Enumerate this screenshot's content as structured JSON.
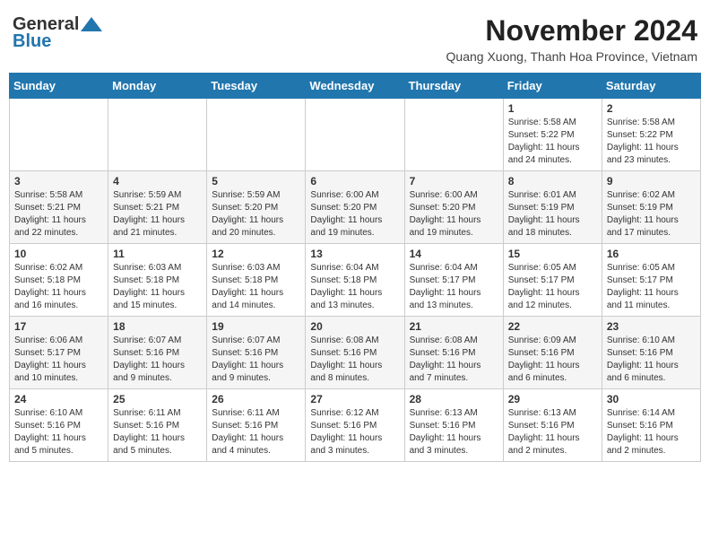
{
  "header": {
    "logo_line1": "General",
    "logo_line2": "Blue",
    "month_title": "November 2024",
    "location": "Quang Xuong, Thanh Hoa Province, Vietnam"
  },
  "weekdays": [
    "Sunday",
    "Monday",
    "Tuesday",
    "Wednesday",
    "Thursday",
    "Friday",
    "Saturday"
  ],
  "weeks": [
    [
      {
        "day": "",
        "info": ""
      },
      {
        "day": "",
        "info": ""
      },
      {
        "day": "",
        "info": ""
      },
      {
        "day": "",
        "info": ""
      },
      {
        "day": "",
        "info": ""
      },
      {
        "day": "1",
        "info": "Sunrise: 5:58 AM\nSunset: 5:22 PM\nDaylight: 11 hours\nand 24 minutes."
      },
      {
        "day": "2",
        "info": "Sunrise: 5:58 AM\nSunset: 5:22 PM\nDaylight: 11 hours\nand 23 minutes."
      }
    ],
    [
      {
        "day": "3",
        "info": "Sunrise: 5:58 AM\nSunset: 5:21 PM\nDaylight: 11 hours\nand 22 minutes."
      },
      {
        "day": "4",
        "info": "Sunrise: 5:59 AM\nSunset: 5:21 PM\nDaylight: 11 hours\nand 21 minutes."
      },
      {
        "day": "5",
        "info": "Sunrise: 5:59 AM\nSunset: 5:20 PM\nDaylight: 11 hours\nand 20 minutes."
      },
      {
        "day": "6",
        "info": "Sunrise: 6:00 AM\nSunset: 5:20 PM\nDaylight: 11 hours\nand 19 minutes."
      },
      {
        "day": "7",
        "info": "Sunrise: 6:00 AM\nSunset: 5:20 PM\nDaylight: 11 hours\nand 19 minutes."
      },
      {
        "day": "8",
        "info": "Sunrise: 6:01 AM\nSunset: 5:19 PM\nDaylight: 11 hours\nand 18 minutes."
      },
      {
        "day": "9",
        "info": "Sunrise: 6:02 AM\nSunset: 5:19 PM\nDaylight: 11 hours\nand 17 minutes."
      }
    ],
    [
      {
        "day": "10",
        "info": "Sunrise: 6:02 AM\nSunset: 5:18 PM\nDaylight: 11 hours\nand 16 minutes."
      },
      {
        "day": "11",
        "info": "Sunrise: 6:03 AM\nSunset: 5:18 PM\nDaylight: 11 hours\nand 15 minutes."
      },
      {
        "day": "12",
        "info": "Sunrise: 6:03 AM\nSunset: 5:18 PM\nDaylight: 11 hours\nand 14 minutes."
      },
      {
        "day": "13",
        "info": "Sunrise: 6:04 AM\nSunset: 5:18 PM\nDaylight: 11 hours\nand 13 minutes."
      },
      {
        "day": "14",
        "info": "Sunrise: 6:04 AM\nSunset: 5:17 PM\nDaylight: 11 hours\nand 13 minutes."
      },
      {
        "day": "15",
        "info": "Sunrise: 6:05 AM\nSunset: 5:17 PM\nDaylight: 11 hours\nand 12 minutes."
      },
      {
        "day": "16",
        "info": "Sunrise: 6:05 AM\nSunset: 5:17 PM\nDaylight: 11 hours\nand 11 minutes."
      }
    ],
    [
      {
        "day": "17",
        "info": "Sunrise: 6:06 AM\nSunset: 5:17 PM\nDaylight: 11 hours\nand 10 minutes."
      },
      {
        "day": "18",
        "info": "Sunrise: 6:07 AM\nSunset: 5:16 PM\nDaylight: 11 hours\nand 9 minutes."
      },
      {
        "day": "19",
        "info": "Sunrise: 6:07 AM\nSunset: 5:16 PM\nDaylight: 11 hours\nand 9 minutes."
      },
      {
        "day": "20",
        "info": "Sunrise: 6:08 AM\nSunset: 5:16 PM\nDaylight: 11 hours\nand 8 minutes."
      },
      {
        "day": "21",
        "info": "Sunrise: 6:08 AM\nSunset: 5:16 PM\nDaylight: 11 hours\nand 7 minutes."
      },
      {
        "day": "22",
        "info": "Sunrise: 6:09 AM\nSunset: 5:16 PM\nDaylight: 11 hours\nand 6 minutes."
      },
      {
        "day": "23",
        "info": "Sunrise: 6:10 AM\nSunset: 5:16 PM\nDaylight: 11 hours\nand 6 minutes."
      }
    ],
    [
      {
        "day": "24",
        "info": "Sunrise: 6:10 AM\nSunset: 5:16 PM\nDaylight: 11 hours\nand 5 minutes."
      },
      {
        "day": "25",
        "info": "Sunrise: 6:11 AM\nSunset: 5:16 PM\nDaylight: 11 hours\nand 5 minutes."
      },
      {
        "day": "26",
        "info": "Sunrise: 6:11 AM\nSunset: 5:16 PM\nDaylight: 11 hours\nand 4 minutes."
      },
      {
        "day": "27",
        "info": "Sunrise: 6:12 AM\nSunset: 5:16 PM\nDaylight: 11 hours\nand 3 minutes."
      },
      {
        "day": "28",
        "info": "Sunrise: 6:13 AM\nSunset: 5:16 PM\nDaylight: 11 hours\nand 3 minutes."
      },
      {
        "day": "29",
        "info": "Sunrise: 6:13 AM\nSunset: 5:16 PM\nDaylight: 11 hours\nand 2 minutes."
      },
      {
        "day": "30",
        "info": "Sunrise: 6:14 AM\nSunset: 5:16 PM\nDaylight: 11 hours\nand 2 minutes."
      }
    ]
  ]
}
